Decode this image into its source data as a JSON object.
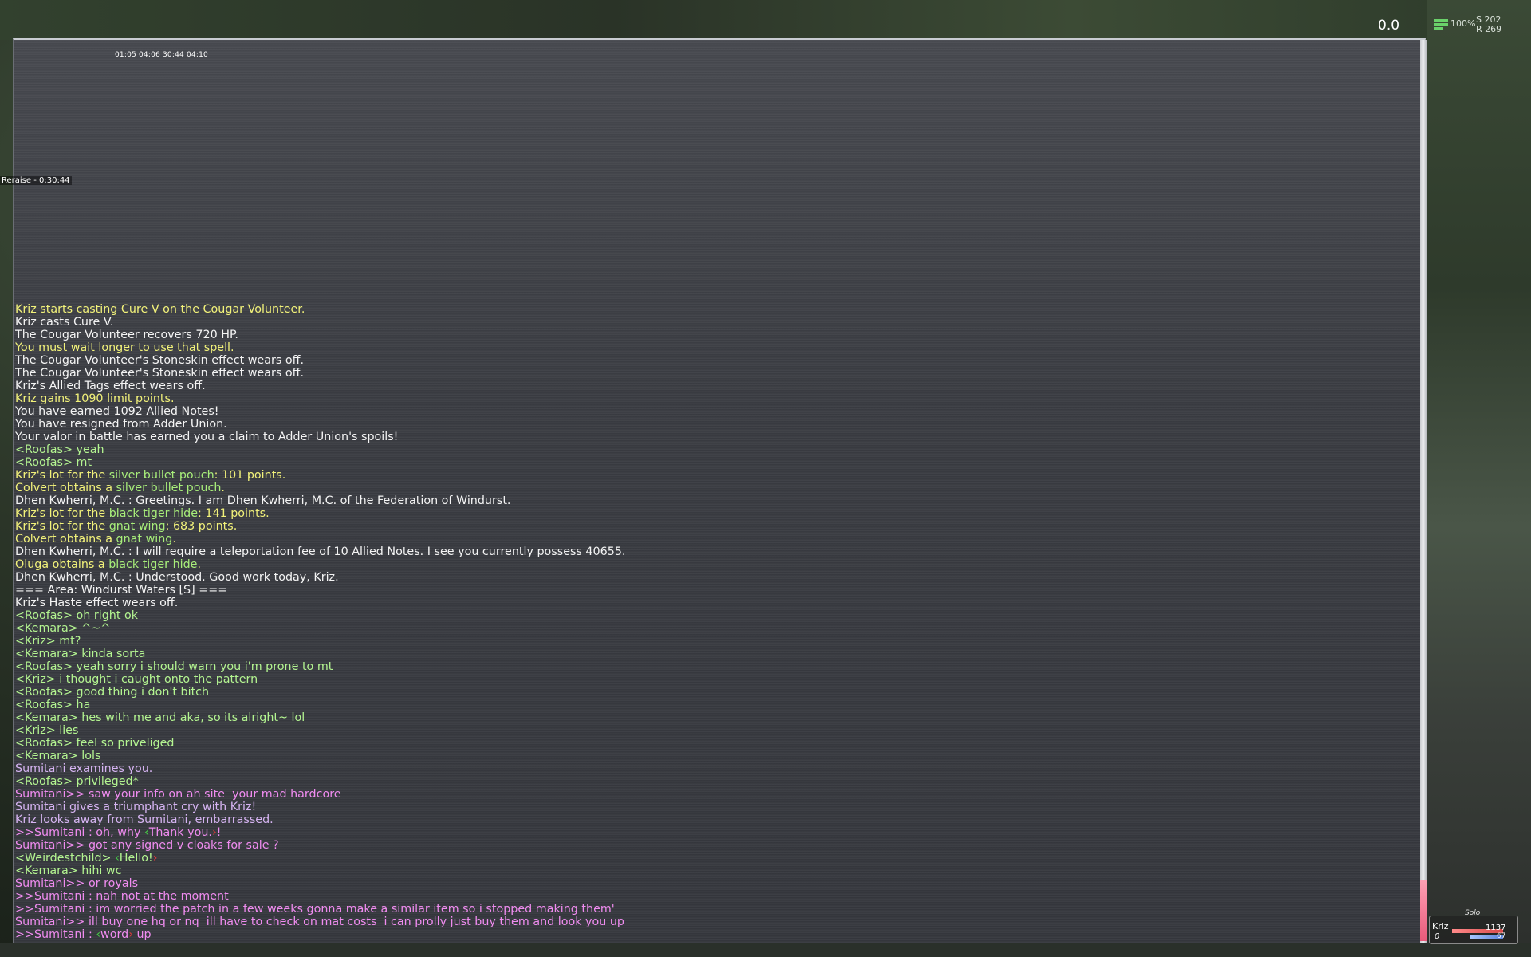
{
  "hud": {
    "target_value": "0.0",
    "signal_percent": "100%",
    "coord_s": "S 202",
    "coord_r": "R 269"
  },
  "timers": "01:05 04:06 30:44 04:10",
  "buff": "Reraise - 0:30:44",
  "log": [
    {
      "c": "yellow",
      "segs": [
        {
          "t": "Kriz starts casting Cure V on the Cougar Volunteer."
        }
      ]
    },
    {
      "c": "white",
      "segs": [
        {
          "t": "Kriz casts Cure V."
        }
      ]
    },
    {
      "c": "white",
      "segs": [
        {
          "t": "The Cougar Volunteer recovers 720 HP."
        }
      ]
    },
    {
      "c": "yellow",
      "segs": [
        {
          "t": "You must wait longer to use that spell."
        }
      ]
    },
    {
      "c": "white",
      "segs": [
        {
          "t": "The Cougar Volunteer's Stoneskin effect wears off."
        }
      ]
    },
    {
      "c": "white",
      "segs": [
        {
          "t": "The Cougar Volunteer's Stoneskin effect wears off."
        }
      ]
    },
    {
      "c": "white",
      "segs": [
        {
          "t": "Kriz's Allied Tags effect wears off."
        }
      ]
    },
    {
      "c": "yellow",
      "segs": [
        {
          "t": "Kriz gains 1090 limit points."
        }
      ]
    },
    {
      "c": "white",
      "segs": [
        {
          "t": "You have earned 1092 Allied Notes!"
        }
      ]
    },
    {
      "c": "white",
      "segs": [
        {
          "t": "You have resigned from Adder Union."
        }
      ]
    },
    {
      "c": "white",
      "segs": [
        {
          "t": "Your valor in battle has earned you a claim to Adder Union's spoils!"
        }
      ]
    },
    {
      "c": "green",
      "segs": [
        {
          "t": "<Roofas> yeah"
        }
      ]
    },
    {
      "c": "green",
      "segs": [
        {
          "t": "<Roofas> mt"
        }
      ]
    },
    {
      "c": "yellow",
      "segs": [
        {
          "t": "Kriz's lot for the "
        },
        {
          "t": "silver bullet pouch",
          "c": "item"
        },
        {
          "t": ": 101 points."
        }
      ]
    },
    {
      "c": "yellow",
      "segs": [
        {
          "t": "Colvert obtains a "
        },
        {
          "t": "silver bullet pouch",
          "c": "item"
        },
        {
          "t": "."
        }
      ]
    },
    {
      "c": "white",
      "segs": [
        {
          "t": "Dhen Kwherri, M.C. : Greetings. I am Dhen Kwherri, M.C. of the Federation of Windurst."
        }
      ]
    },
    {
      "c": "yellow",
      "segs": [
        {
          "t": "Kriz's lot for the "
        },
        {
          "t": "black tiger hide",
          "c": "item"
        },
        {
          "t": ": 141 points."
        }
      ]
    },
    {
      "c": "yellow",
      "segs": [
        {
          "t": "Kriz's lot for the "
        },
        {
          "t": "gnat wing",
          "c": "item"
        },
        {
          "t": ": 683 points."
        }
      ]
    },
    {
      "c": "yellow",
      "segs": [
        {
          "t": "Colvert obtains a "
        },
        {
          "t": "gnat wing",
          "c": "item"
        },
        {
          "t": "."
        }
      ]
    },
    {
      "c": "white",
      "segs": [
        {
          "t": "Dhen Kwherri, M.C. : I will require a teleportation fee of 10 Allied Notes. I see you currently possess 40655."
        }
      ]
    },
    {
      "c": "yellow",
      "segs": [
        {
          "t": "Oluga obtains a "
        },
        {
          "t": "black tiger hide",
          "c": "item"
        },
        {
          "t": "."
        }
      ]
    },
    {
      "c": "white",
      "segs": [
        {
          "t": "Dhen Kwherri, M.C. : Understood. Good work today, Kriz."
        }
      ]
    },
    {
      "c": "white",
      "segs": [
        {
          "t": "=== Area: Windurst Waters [S] ==="
        }
      ]
    },
    {
      "c": "white",
      "segs": [
        {
          "t": "Kriz's Haste effect wears off."
        }
      ]
    },
    {
      "c": "green",
      "segs": [
        {
          "t": "<Roofas> oh right ok"
        }
      ]
    },
    {
      "c": "green",
      "segs": [
        {
          "t": "<Kemara> ^~^"
        }
      ]
    },
    {
      "c": "green",
      "segs": [
        {
          "t": "<Kriz> mt?"
        }
      ]
    },
    {
      "c": "green",
      "segs": [
        {
          "t": "<Kemara> kinda sorta"
        }
      ]
    },
    {
      "c": "green",
      "segs": [
        {
          "t": "<Roofas> yeah sorry i should warn you i'm prone to mt"
        }
      ]
    },
    {
      "c": "green",
      "segs": [
        {
          "t": "<Kriz> i thought i caught onto the pattern"
        }
      ]
    },
    {
      "c": "green",
      "segs": [
        {
          "t": "<Roofas> good thing i don't bitch"
        }
      ]
    },
    {
      "c": "green",
      "segs": [
        {
          "t": "<Roofas> ha"
        }
      ]
    },
    {
      "c": "green",
      "segs": [
        {
          "t": "<Kemara> hes with me and aka, so its alright~ lol"
        }
      ]
    },
    {
      "c": "green",
      "segs": [
        {
          "t": "<Kriz> lies"
        }
      ]
    },
    {
      "c": "green",
      "segs": [
        {
          "t": "<Roofas> feel so priveliged"
        }
      ]
    },
    {
      "c": "green",
      "segs": [
        {
          "t": "<Kemara> lols"
        }
      ]
    },
    {
      "c": "lav",
      "segs": [
        {
          "t": "Sumitani examines you."
        }
      ]
    },
    {
      "c": "green",
      "segs": [
        {
          "t": "<Roofas> privileged*"
        }
      ]
    },
    {
      "c": "pink",
      "segs": [
        {
          "t": "Sumitani>> saw your info on ah site  your mad hardcore"
        }
      ]
    },
    {
      "c": "lav",
      "segs": [
        {
          "t": "Sumitani gives a triumphant cry with Kriz!"
        }
      ]
    },
    {
      "c": "lav",
      "segs": [
        {
          "t": "Kriz looks away from Sumitani, embarrassed."
        }
      ]
    },
    {
      "c": "pink",
      "segs": [
        {
          "t": ">>Sumitani : oh, why "
        },
        {
          "t": "‹",
          "c": "mark-g"
        },
        {
          "t": "Thank you."
        },
        {
          "t": "›",
          "c": "mark-r"
        },
        {
          "t": "!"
        }
      ]
    },
    {
      "c": "pink",
      "segs": [
        {
          "t": "Sumitani>> got any signed v cloaks for sale ?"
        }
      ]
    },
    {
      "c": "green",
      "segs": [
        {
          "t": "<Weirdestchild> "
        },
        {
          "t": "‹",
          "c": "mark-g"
        },
        {
          "t": "Hello!"
        },
        {
          "t": "›",
          "c": "mark-r"
        }
      ]
    },
    {
      "c": "green",
      "segs": [
        {
          "t": "<Kemara> hihi wc"
        }
      ]
    },
    {
      "c": "pink",
      "segs": [
        {
          "t": "Sumitani>> or royals"
        }
      ]
    },
    {
      "c": "pink",
      "segs": [
        {
          "t": ">>Sumitani : nah not at the moment"
        }
      ]
    },
    {
      "c": "pink",
      "segs": [
        {
          "t": ">>Sumitani : im worried the patch in a few weeks gonna make a similar item so i stopped making them'"
        }
      ]
    },
    {
      "c": "pink",
      "segs": [
        {
          "t": "Sumitani>> ill buy one hq or nq  ill have to check on mat costs  i can prolly just buy them and look you up"
        }
      ]
    },
    {
      "c": "pink",
      "segs": [
        {
          "t": ">>Sumitani : "
        },
        {
          "t": "‹",
          "c": "mark-g"
        },
        {
          "t": "word"
        },
        {
          "t": "›",
          "c": "mark-r"
        },
        {
          "t": " up"
        }
      ]
    }
  ],
  "party": {
    "mode": "Solo",
    "name": "Kriz",
    "tp": "0",
    "hp": "1137",
    "mp": "67"
  }
}
